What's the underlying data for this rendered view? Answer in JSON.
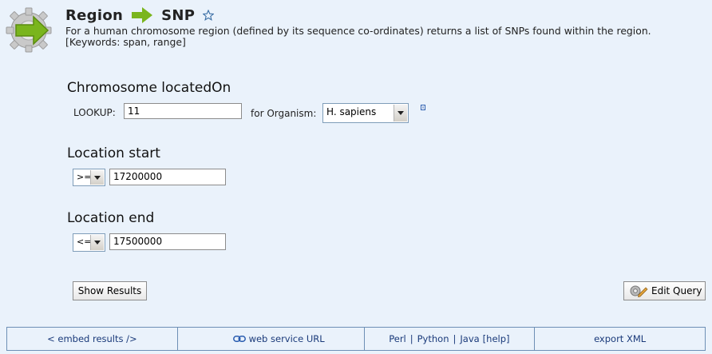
{
  "header": {
    "from": "Region",
    "to": "SNP",
    "description": "For a human chromosome region (defined by its sequence co-ordinates) returns a list of SNPs found within the region.",
    "keywords": "[Keywords: span, range]"
  },
  "chromosome": {
    "title": "Chromosome locatedOn",
    "lookup_label": "LOOKUP:",
    "lookup_value": "11",
    "organism_label": "for Organism:",
    "organism_value": "H. sapiens"
  },
  "start": {
    "title": "Location start",
    "operator": ">=",
    "value": "17200000"
  },
  "end": {
    "title": "Location end",
    "operator": "<=",
    "value": "17500000"
  },
  "buttons": {
    "show_results": "Show Results",
    "edit_query": "Edit Query"
  },
  "footer": {
    "embed": "< embed results />",
    "web_service": "web service URL",
    "perl": "Perl",
    "python": "Python",
    "java": "Java",
    "help": "[help]",
    "export": "export XML"
  },
  "colors": {
    "background": "#eaf2fb",
    "arrow_green": "#7ab51d",
    "link_blue": "#1a3a7a"
  }
}
